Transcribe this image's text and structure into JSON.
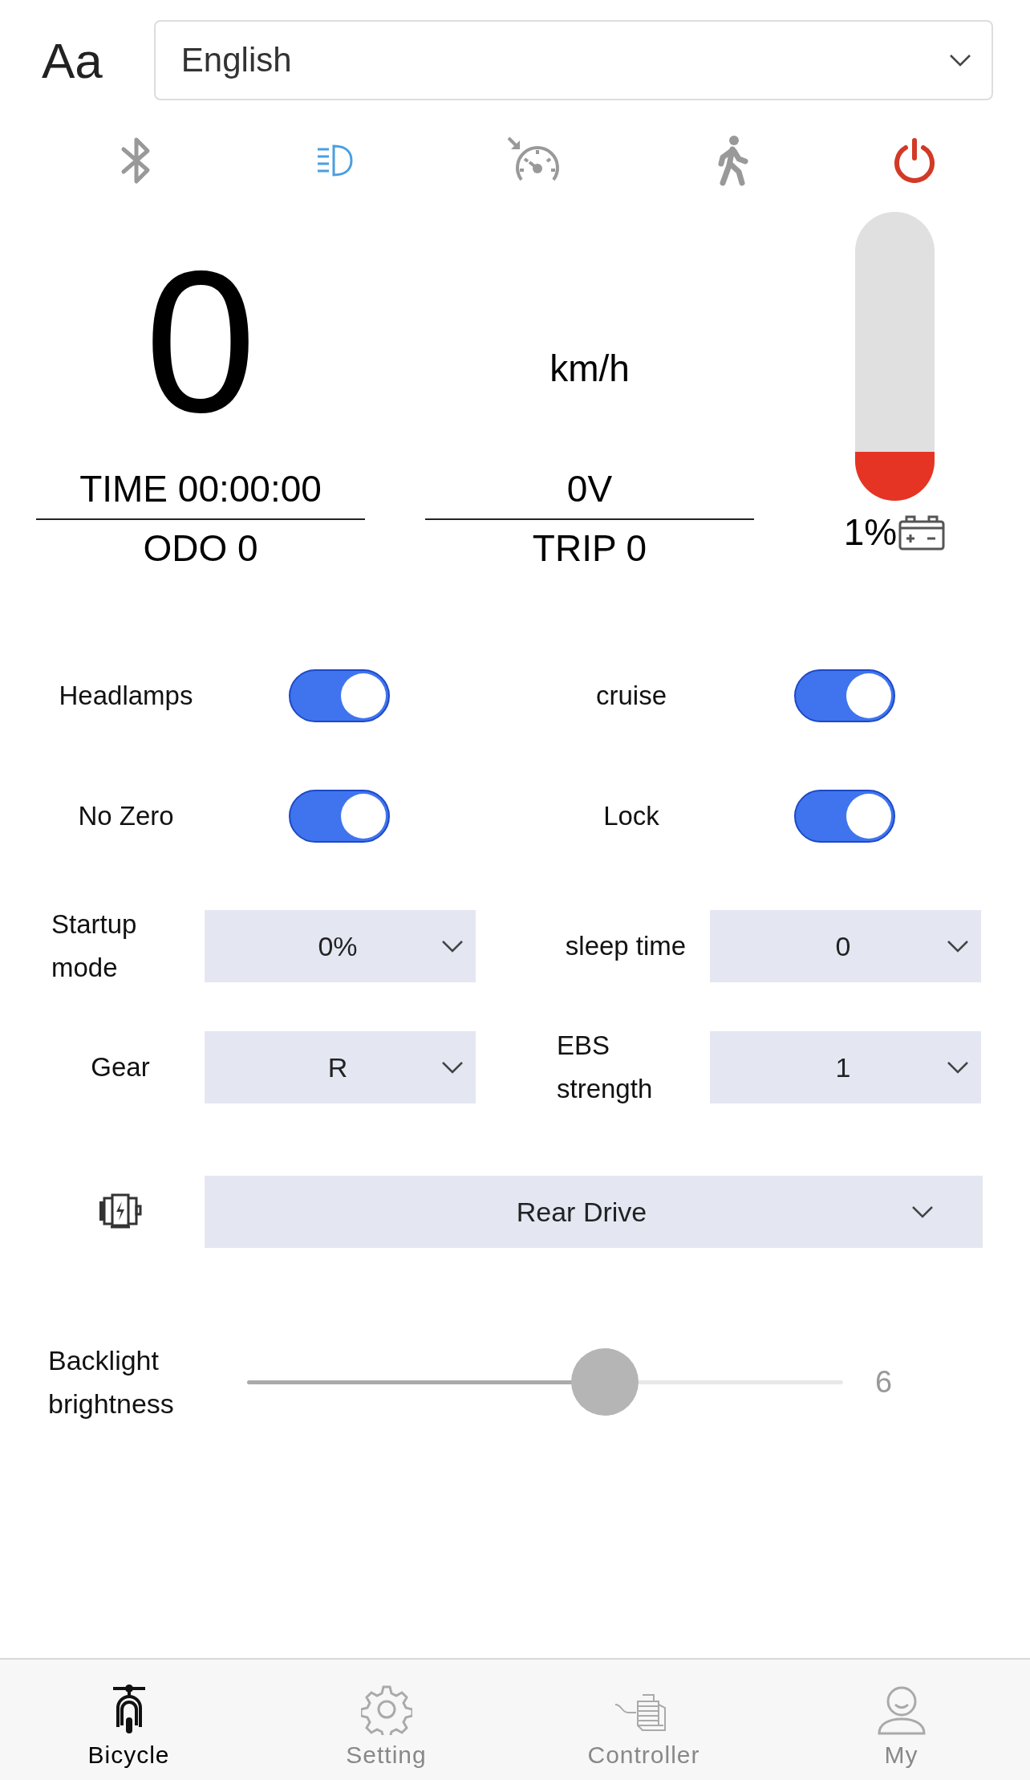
{
  "language_select": {
    "icon": "Aa",
    "value": "English"
  },
  "status_icons": [
    {
      "kind": "bluetooth",
      "on": false
    },
    {
      "kind": "headlight",
      "on": true
    },
    {
      "kind": "cruise",
      "on": false
    },
    {
      "kind": "walk",
      "on": false
    },
    {
      "kind": "power",
      "on": true
    }
  ],
  "speed": {
    "value": "0",
    "unit": "km/h"
  },
  "stats": [
    [
      "TIME 00:00:00",
      "ODO 0"
    ],
    [
      "0V",
      "TRIP 0"
    ]
  ],
  "battery": {
    "level": 0.17,
    "percent": "1%"
  },
  "switches": [
    {
      "label": "Headlamps",
      "on": true
    },
    {
      "label": "cruise",
      "on": true
    },
    {
      "label": "No Zero",
      "on": true
    },
    {
      "label": "Lock",
      "on": true
    }
  ],
  "selects": [
    {
      "label": "Startup mode",
      "value": "0%"
    },
    {
      "label": "sleep time",
      "value": "0"
    },
    {
      "label": "Gear",
      "value": "R"
    },
    {
      "label": "EBS strength",
      "value": "1"
    }
  ],
  "drive": {
    "value": "Rear Drive"
  },
  "backlight": {
    "label": "Backlight brightness",
    "level": 0.6,
    "reading": "6"
  },
  "tabs": [
    {
      "kind": "scooter",
      "label": "Bicycle",
      "selected": true
    },
    {
      "kind": "gear",
      "label": "Setting",
      "selected": false
    },
    {
      "kind": "controller",
      "label": "Controller",
      "selected": false
    },
    {
      "kind": "person",
      "label": "My",
      "selected": false
    }
  ]
}
